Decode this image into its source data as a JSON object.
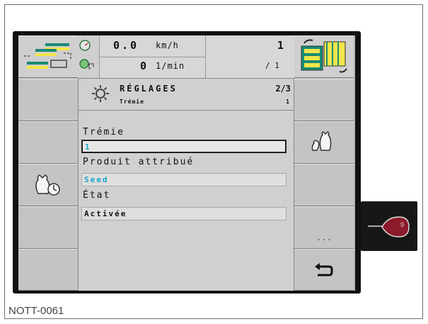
{
  "status": {
    "speed_value": "0.0",
    "speed_unit": "km/h",
    "rpm_value": "0",
    "rpm_unit": "1/min",
    "counter_top": "1",
    "counter_bottom": "/ 1"
  },
  "dialog": {
    "title": "RÉGLAGES",
    "page": "2/3",
    "subtitle": "Trémie",
    "subtitle_value": "1",
    "fields": [
      {
        "label": "Trémie",
        "value": "1"
      },
      {
        "label": "Produit attribué",
        "value": "Seed"
      },
      {
        "label": "État",
        "value": "Activée"
      }
    ]
  },
  "softkeys": {
    "more_label": "..."
  },
  "side_tab_label": "9",
  "caption": "NOTT-0061",
  "colors": {
    "highlight_value": "#1aa6c8",
    "screen_bg": "#b7b7b7",
    "field_bg": "#dedede",
    "tab_red": "#8b1a2b",
    "hopper_yellow": "#f2e64a",
    "hopper_teal": "#1a8a73"
  },
  "icons": {
    "implement": "implement-layout-icon",
    "speedometer": "speedometer-icon",
    "tractor_rpm": "rpm-icon",
    "hopper_switch": "hopper-switch-icon",
    "settings": "gear-icon",
    "seed_bag": "seed-bag-icon",
    "seed_bag_timer": "seed-bag-timer-icon",
    "return": "return-icon"
  }
}
